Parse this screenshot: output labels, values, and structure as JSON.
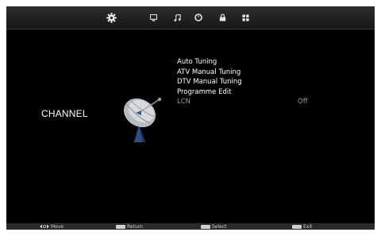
{
  "header": {
    "tabs": [
      {
        "icon": "gear-icon",
        "active": true
      },
      {
        "icon": "monitor-icon",
        "active": false
      },
      {
        "icon": "music-note-icon",
        "active": false
      },
      {
        "icon": "clock-icon",
        "active": false
      },
      {
        "icon": "lock-icon",
        "active": false
      },
      {
        "icon": "grid-icon",
        "active": false
      }
    ]
  },
  "section": {
    "title": "CHANNEL",
    "icon": "satellite-dish-icon"
  },
  "menu": {
    "items": [
      {
        "label": "Auto Tuning",
        "value": ""
      },
      {
        "label": "ATV Manual Tuning",
        "value": ""
      },
      {
        "label": "DTV Manual Tuning",
        "value": ""
      },
      {
        "label": "Programme Edit",
        "value": ""
      },
      {
        "label": "LCN",
        "value": "Off"
      }
    ]
  },
  "footer": {
    "move_label": "Move",
    "return_label": "Return",
    "select_label": "Select",
    "exit_label": "Exit"
  },
  "colors": {
    "background": "#000000",
    "topbar": "#232323",
    "text": "#ffffff",
    "dim_text": "#9a9a9a",
    "dish_blue": "#2c4f86"
  }
}
